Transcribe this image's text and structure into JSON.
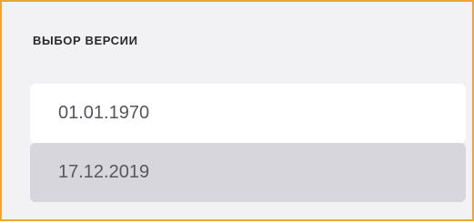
{
  "panel": {
    "title": "ВЫБОР ВЕРСИИ",
    "border_color": "#f0a431",
    "background": "#f2f2f4"
  },
  "versions": [
    {
      "label": "01.01.1970",
      "selected": false
    },
    {
      "label": "17.12.2019",
      "selected": true
    }
  ],
  "colors": {
    "option_bg": "#ffffff",
    "selected_bg": "#d6d6dc",
    "text": "#55565c"
  }
}
